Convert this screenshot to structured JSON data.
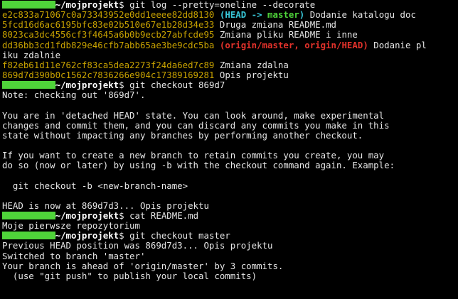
{
  "prompt": {
    "path": "~/mojprojekt",
    "symbol": "$"
  },
  "colors": {
    "background": "#000000",
    "text": "#e6e6e6",
    "hash": "#c8a200",
    "head_decor": "#38c7d8",
    "branch_decor": "#4fd43a",
    "remote_decor": "#e3322b",
    "redaction": "#4fd43a"
  },
  "commands": {
    "log": "git log --pretty=oneline --decorate",
    "checkout": "git checkout 869d7",
    "cat": "cat README.md",
    "checkout_master": "git checkout master"
  },
  "log": [
    {
      "hash": "e2c833a71067c0a73343952e0dd1eeee82dd8130",
      "decor_open": "(",
      "decor_head": "HEAD -> ",
      "decor_master": "master",
      "decor_close": ")",
      "message": "Dodanie katalogu doc"
    },
    {
      "hash": "5fcd16d6ac6195bfc83e02b510e67e1b28d34e33",
      "message": "Druga zmiana README.md"
    },
    {
      "hash": "8023ca3dc4556cf3f4645a6b0b9ecb27abfcde95",
      "message": "Zmiana pliku README i inne"
    },
    {
      "hash": "dd36bb3cd1fdb829e46cfb7abb65ae3be9cdc5ba",
      "decor_open": "(",
      "decor_remote": "origin/master, origin/HEAD",
      "decor_close": ")",
      "message_start": "Dodanie pl",
      "message_wrap": "iku zdalnie"
    },
    {
      "hash": "f82eb61d11e762cf83ca5dea2273f24da6ed7c89",
      "message": "Zmiana zdalna"
    },
    {
      "hash": "869d7d390b0c1562c7836266e904c17389169281",
      "message": "Opis projektu"
    }
  ],
  "checkout_output": [
    "Note: checking out '869d7'.",
    "",
    "You are in 'detached HEAD' state. You can look around, make experimental",
    "changes and commit them, and you can discard any commits you make in this",
    "state without impacting any branches by performing another checkout.",
    "",
    "If you want to create a new branch to retain commits you create, you may",
    "do so (now or later) by using -b with the checkout command again. Example:",
    "",
    "  git checkout -b <new-branch-name>",
    "",
    "HEAD is now at 869d7d3... Opis projektu"
  ],
  "cat_output": [
    "Moje pierwsze repozytorium"
  ],
  "checkout_master_output": [
    "Previous HEAD position was 869d7d3... Opis projektu",
    "Switched to branch 'master'",
    "Your branch is ahead of 'origin/master' by 3 commits.",
    "  (use \"git push\" to publish your local commits)"
  ]
}
